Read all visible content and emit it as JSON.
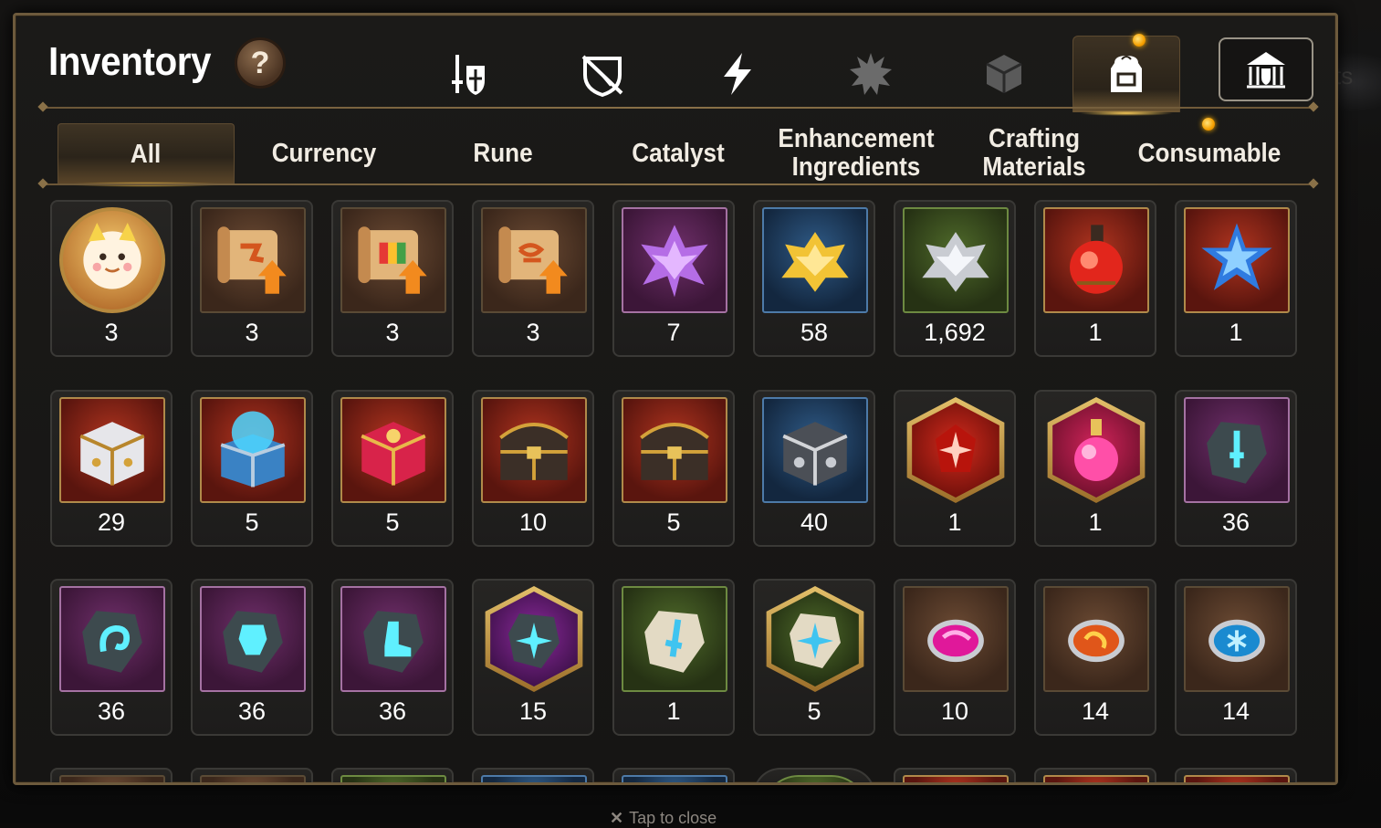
{
  "window": {
    "title": "Inventory",
    "help_label": "?"
  },
  "category_tabs": [
    {
      "icon": "sword-shield-icon",
      "active": false
    },
    {
      "icon": "broken-shield-icon",
      "active": false
    },
    {
      "icon": "lightning-icon",
      "active": false
    },
    {
      "icon": "spiked-emblem-icon",
      "active": false
    },
    {
      "icon": "cube-icon",
      "active": false
    },
    {
      "icon": "backpack-icon",
      "active": true
    },
    {
      "icon": "guild-hall-icon",
      "active": false
    }
  ],
  "sub_tabs": [
    {
      "label": "All",
      "active": true
    },
    {
      "label": "Currency",
      "active": false
    },
    {
      "label": "Rune",
      "active": false
    },
    {
      "label": "Catalyst",
      "active": false
    },
    {
      "label": "Enhancement\nIngredients",
      "active": false
    },
    {
      "label": "Crafting\nMaterials",
      "active": false
    },
    {
      "label": "Consumable",
      "active": false
    }
  ],
  "items": [
    {
      "icon": "mascot-medal-icon",
      "qty": "3"
    },
    {
      "icon": "scroll-fire-upgrade-icon",
      "qty": "3"
    },
    {
      "icon": "scroll-rainbow-upgrade-icon",
      "qty": "3"
    },
    {
      "icon": "scroll-symbol-upgrade-icon",
      "qty": "3"
    },
    {
      "icon": "purple-crystal-flower-icon",
      "qty": "7"
    },
    {
      "icon": "gold-crystal-flower-icon",
      "qty": "58"
    },
    {
      "icon": "silver-crystal-flower-icon",
      "qty": "1,692"
    },
    {
      "icon": "red-potion-icon",
      "qty": "1"
    },
    {
      "icon": "star-potion-icon",
      "qty": "1"
    },
    {
      "icon": "silver-chest-icon",
      "qty": "29"
    },
    {
      "icon": "blue-orb-chest-icon",
      "qty": "5"
    },
    {
      "icon": "red-chest-icon",
      "qty": "5"
    },
    {
      "icon": "dark-treasure-chest-icon",
      "qty": "10"
    },
    {
      "icon": "dark-treasure-chest-icon",
      "qty": "5"
    },
    {
      "icon": "steel-chest-icon",
      "qty": "40"
    },
    {
      "icon": "red-star-stone-icon",
      "qty": "1"
    },
    {
      "icon": "pink-potion-icon",
      "qty": "1"
    },
    {
      "icon": "sword-rune-stone-icon",
      "qty": "36"
    },
    {
      "icon": "swirl-rune-stone-icon",
      "qty": "36"
    },
    {
      "icon": "armor-rune-stone-icon",
      "qty": "36"
    },
    {
      "icon": "boot-rune-stone-icon",
      "qty": "36"
    },
    {
      "icon": "star-rune-stone-icon",
      "qty": "15"
    },
    {
      "icon": "sword-pale-stone-icon",
      "qty": "1"
    },
    {
      "icon": "star-pale-stone-icon",
      "qty": "5"
    },
    {
      "icon": "pink-gem-icon",
      "qty": "10"
    },
    {
      "icon": "orange-gem-icon",
      "qty": "14"
    },
    {
      "icon": "blue-snowflake-gem-icon",
      "qty": "14"
    }
  ],
  "ghost_text": "ts",
  "close_hint": "Tap to close"
}
